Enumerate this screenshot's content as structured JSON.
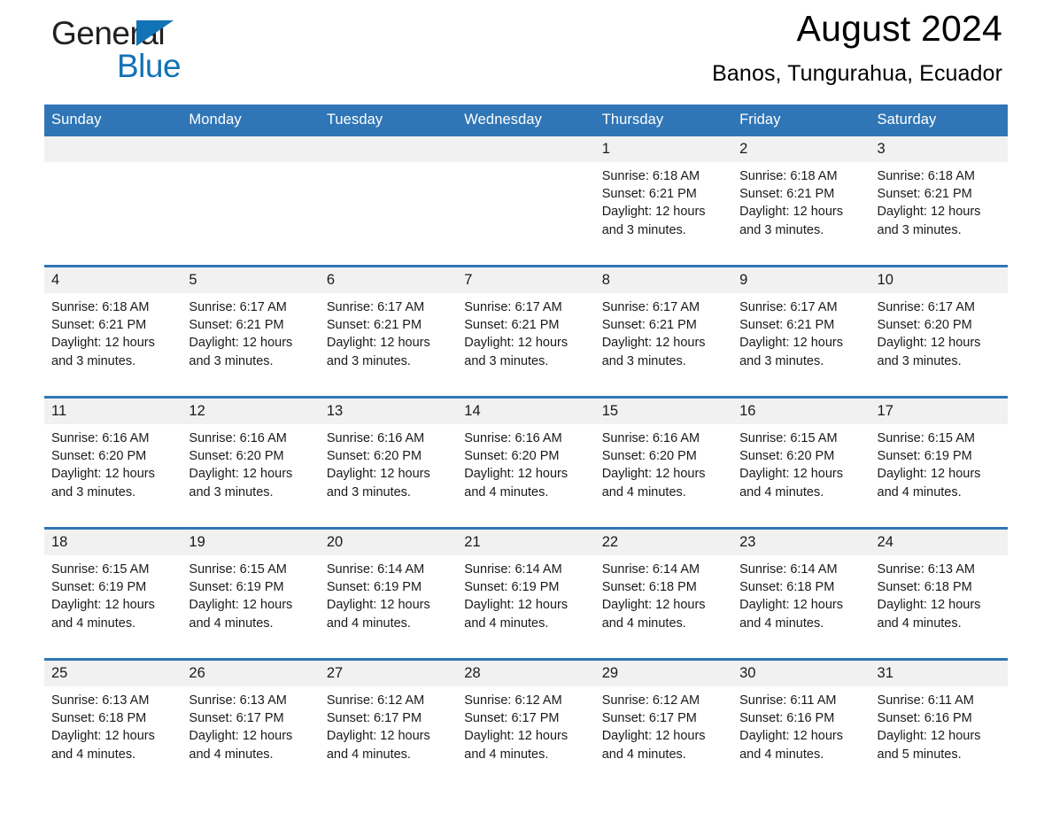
{
  "logo": {
    "word1": "General",
    "word2": "Blue",
    "triangle_color": "#1272b6",
    "text_color": "#231f20"
  },
  "header": {
    "title": "August 2024",
    "subtitle": "Banos, Tungurahua, Ecuador"
  },
  "theme": {
    "header_blue": "#3076b6",
    "daynum_band": "#f1f1f1",
    "cell_background": "#ffffff",
    "text": "#1a1a1a"
  },
  "weekday_headers": [
    "Sunday",
    "Monday",
    "Tuesday",
    "Wednesday",
    "Thursday",
    "Friday",
    "Saturday"
  ],
  "weeks": [
    {
      "days": [
        {
          "date": "",
          "lines": []
        },
        {
          "date": "",
          "lines": []
        },
        {
          "date": "",
          "lines": []
        },
        {
          "date": "",
          "lines": []
        },
        {
          "date": "1",
          "lines": [
            "Sunrise: 6:18 AM",
            "Sunset: 6:21 PM",
            "Daylight: 12 hours",
            "and 3 minutes."
          ]
        },
        {
          "date": "2",
          "lines": [
            "Sunrise: 6:18 AM",
            "Sunset: 6:21 PM",
            "Daylight: 12 hours",
            "and 3 minutes."
          ]
        },
        {
          "date": "3",
          "lines": [
            "Sunrise: 6:18 AM",
            "Sunset: 6:21 PM",
            "Daylight: 12 hours",
            "and 3 minutes."
          ]
        }
      ]
    },
    {
      "days": [
        {
          "date": "4",
          "lines": [
            "Sunrise: 6:18 AM",
            "Sunset: 6:21 PM",
            "Daylight: 12 hours",
            "and 3 minutes."
          ]
        },
        {
          "date": "5",
          "lines": [
            "Sunrise: 6:17 AM",
            "Sunset: 6:21 PM",
            "Daylight: 12 hours",
            "and 3 minutes."
          ]
        },
        {
          "date": "6",
          "lines": [
            "Sunrise: 6:17 AM",
            "Sunset: 6:21 PM",
            "Daylight: 12 hours",
            "and 3 minutes."
          ]
        },
        {
          "date": "7",
          "lines": [
            "Sunrise: 6:17 AM",
            "Sunset: 6:21 PM",
            "Daylight: 12 hours",
            "and 3 minutes."
          ]
        },
        {
          "date": "8",
          "lines": [
            "Sunrise: 6:17 AM",
            "Sunset: 6:21 PM",
            "Daylight: 12 hours",
            "and 3 minutes."
          ]
        },
        {
          "date": "9",
          "lines": [
            "Sunrise: 6:17 AM",
            "Sunset: 6:21 PM",
            "Daylight: 12 hours",
            "and 3 minutes."
          ]
        },
        {
          "date": "10",
          "lines": [
            "Sunrise: 6:17 AM",
            "Sunset: 6:20 PM",
            "Daylight: 12 hours",
            "and 3 minutes."
          ]
        }
      ]
    },
    {
      "days": [
        {
          "date": "11",
          "lines": [
            "Sunrise: 6:16 AM",
            "Sunset: 6:20 PM",
            "Daylight: 12 hours",
            "and 3 minutes."
          ]
        },
        {
          "date": "12",
          "lines": [
            "Sunrise: 6:16 AM",
            "Sunset: 6:20 PM",
            "Daylight: 12 hours",
            "and 3 minutes."
          ]
        },
        {
          "date": "13",
          "lines": [
            "Sunrise: 6:16 AM",
            "Sunset: 6:20 PM",
            "Daylight: 12 hours",
            "and 3 minutes."
          ]
        },
        {
          "date": "14",
          "lines": [
            "Sunrise: 6:16 AM",
            "Sunset: 6:20 PM",
            "Daylight: 12 hours",
            "and 4 minutes."
          ]
        },
        {
          "date": "15",
          "lines": [
            "Sunrise: 6:16 AM",
            "Sunset: 6:20 PM",
            "Daylight: 12 hours",
            "and 4 minutes."
          ]
        },
        {
          "date": "16",
          "lines": [
            "Sunrise: 6:15 AM",
            "Sunset: 6:20 PM",
            "Daylight: 12 hours",
            "and 4 minutes."
          ]
        },
        {
          "date": "17",
          "lines": [
            "Sunrise: 6:15 AM",
            "Sunset: 6:19 PM",
            "Daylight: 12 hours",
            "and 4 minutes."
          ]
        }
      ]
    },
    {
      "days": [
        {
          "date": "18",
          "lines": [
            "Sunrise: 6:15 AM",
            "Sunset: 6:19 PM",
            "Daylight: 12 hours",
            "and 4 minutes."
          ]
        },
        {
          "date": "19",
          "lines": [
            "Sunrise: 6:15 AM",
            "Sunset: 6:19 PM",
            "Daylight: 12 hours",
            "and 4 minutes."
          ]
        },
        {
          "date": "20",
          "lines": [
            "Sunrise: 6:14 AM",
            "Sunset: 6:19 PM",
            "Daylight: 12 hours",
            "and 4 minutes."
          ]
        },
        {
          "date": "21",
          "lines": [
            "Sunrise: 6:14 AM",
            "Sunset: 6:19 PM",
            "Daylight: 12 hours",
            "and 4 minutes."
          ]
        },
        {
          "date": "22",
          "lines": [
            "Sunrise: 6:14 AM",
            "Sunset: 6:18 PM",
            "Daylight: 12 hours",
            "and 4 minutes."
          ]
        },
        {
          "date": "23",
          "lines": [
            "Sunrise: 6:14 AM",
            "Sunset: 6:18 PM",
            "Daylight: 12 hours",
            "and 4 minutes."
          ]
        },
        {
          "date": "24",
          "lines": [
            "Sunrise: 6:13 AM",
            "Sunset: 6:18 PM",
            "Daylight: 12 hours",
            "and 4 minutes."
          ]
        }
      ]
    },
    {
      "days": [
        {
          "date": "25",
          "lines": [
            "Sunrise: 6:13 AM",
            "Sunset: 6:18 PM",
            "Daylight: 12 hours",
            "and 4 minutes."
          ]
        },
        {
          "date": "26",
          "lines": [
            "Sunrise: 6:13 AM",
            "Sunset: 6:17 PM",
            "Daylight: 12 hours",
            "and 4 minutes."
          ]
        },
        {
          "date": "27",
          "lines": [
            "Sunrise: 6:12 AM",
            "Sunset: 6:17 PM",
            "Daylight: 12 hours",
            "and 4 minutes."
          ]
        },
        {
          "date": "28",
          "lines": [
            "Sunrise: 6:12 AM",
            "Sunset: 6:17 PM",
            "Daylight: 12 hours",
            "and 4 minutes."
          ]
        },
        {
          "date": "29",
          "lines": [
            "Sunrise: 6:12 AM",
            "Sunset: 6:17 PM",
            "Daylight: 12 hours",
            "and 4 minutes."
          ]
        },
        {
          "date": "30",
          "lines": [
            "Sunrise: 6:11 AM",
            "Sunset: 6:16 PM",
            "Daylight: 12 hours",
            "and 4 minutes."
          ]
        },
        {
          "date": "31",
          "lines": [
            "Sunrise: 6:11 AM",
            "Sunset: 6:16 PM",
            "Daylight: 12 hours",
            "and 5 minutes."
          ]
        }
      ]
    }
  ]
}
